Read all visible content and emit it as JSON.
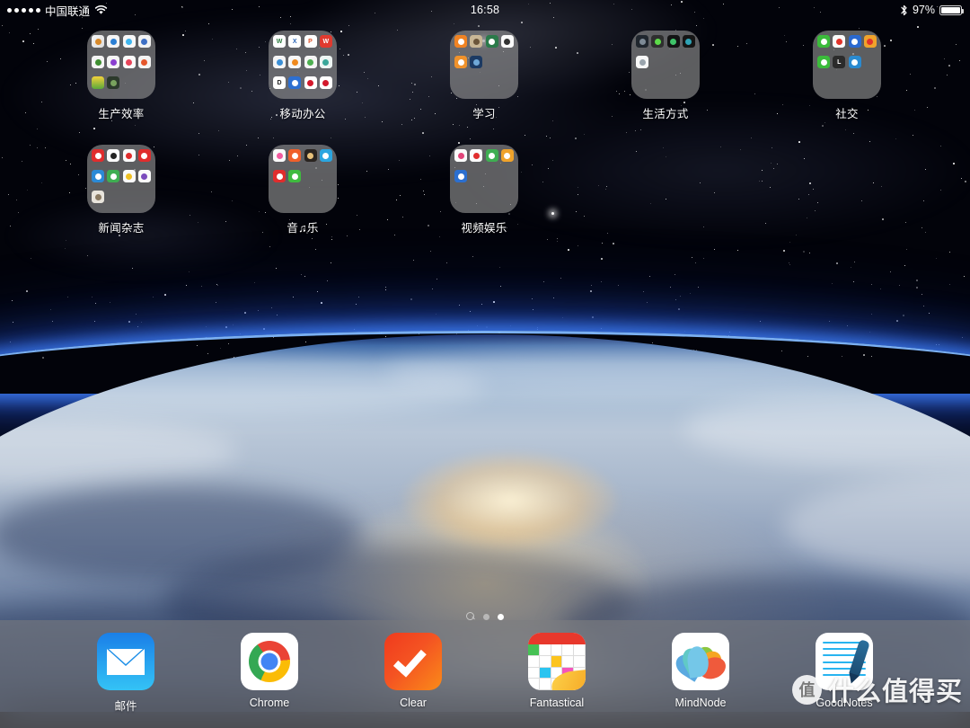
{
  "status_bar": {
    "signal_dots": 5,
    "carrier": "中国联通",
    "wifi_icon": "wifi-icon",
    "time": "16:58",
    "bluetooth_icon": "bluetooth-icon",
    "battery_percent": "97%",
    "battery_icon": "battery-icon"
  },
  "home_screen": {
    "rows": [
      [
        {
          "label": "生产效率",
          "type": "folder",
          "mini_icons": [
            {
              "name": "omnifocus-icon",
              "bg": "linear-gradient(135deg,#f6f6f6,#ddd)",
              "glyph": "",
              "dot": "#d88a2b"
            },
            {
              "name": "onedrive-icon",
              "bg": "#f4f4f4",
              "glyph": "",
              "dot": "#2b7fd4"
            },
            {
              "name": "icloud-drive-icon",
              "bg": "#f7f7f7",
              "glyph": "",
              "dot": "#3fb6ef"
            },
            {
              "name": "documents-icon",
              "bg": "#f2f2f2",
              "glyph": "",
              "dot": "#3d6fc4"
            },
            {
              "name": "evernote-icon",
              "bg": "#f4f4f4",
              "glyph": "",
              "dot": "#3f8f32"
            },
            {
              "name": "notability-icon",
              "bg": "#f4f4f4",
              "glyph": "",
              "dot": "#8a3fd0"
            },
            {
              "name": "pinwheel-icon",
              "bg": "#fbfbfb",
              "glyph": "",
              "dot": "#e8455a"
            },
            {
              "name": "clock-icon",
              "bg": "#f4f4f4",
              "glyph": "",
              "dot": "#e4562b"
            },
            {
              "name": "yellow-app-icon",
              "bg": "linear-gradient(#f3d23b,#5aa83b)",
              "glyph": "",
              "dot": ""
            },
            {
              "name": "dark-app-icon",
              "bg": "#2c3a2c",
              "glyph": "",
              "dot": "#79a35e"
            }
          ]
        },
        {
          "label": "移动办公",
          "type": "folder",
          "mini_icons": [
            {
              "name": "word-icon",
              "bg": "#fff",
              "glyph": "W",
              "dot": "#2b7a3f"
            },
            {
              "name": "excel-icon",
              "bg": "#fff",
              "glyph": "X",
              "dot": "#2b66b8"
            },
            {
              "name": "powerpoint-icon",
              "bg": "#fff",
              "glyph": "P",
              "dot": "#e0542a"
            },
            {
              "name": "wps-icon",
              "bg": "#e03a2f",
              "glyph": "W",
              "dot": "#ffffff"
            },
            {
              "name": "keynote-icon",
              "bg": "#f5f5f5",
              "glyph": "",
              "dot": "#3b8fd6"
            },
            {
              "name": "pages-icon",
              "bg": "#f7f7f7",
              "glyph": "",
              "dot": "#f08a1e"
            },
            {
              "name": "numbers-icon",
              "bg": "#f5f5f5",
              "glyph": "",
              "dot": "#4caf50"
            },
            {
              "name": "scanner-icon",
              "bg": "#eef6f4",
              "glyph": "",
              "dot": "#3aa79a"
            },
            {
              "name": "pdf-icon",
              "bg": "#fff",
              "glyph": "D",
              "dot": "#222222"
            },
            {
              "name": "blue-tool-icon",
              "bg": "#2d6fd0",
              "glyph": "",
              "dot": "#ffffff"
            },
            {
              "name": "red-ring-icon",
              "bg": "#fff",
              "glyph": "",
              "dot": "#d3182c"
            },
            {
              "name": "download-icon",
              "bg": "#fff",
              "glyph": "",
              "dot": "#d3182c"
            }
          ]
        },
        {
          "label": "学习",
          "type": "folder",
          "mini_icons": [
            {
              "name": "orange-study-icon",
              "bg": "#f08323",
              "glyph": "",
              "dot": "#ffffff"
            },
            {
              "name": "books-icon",
              "bg": "#c9b796",
              "glyph": "",
              "dot": "#6b553a"
            },
            {
              "name": "green-board-icon",
              "bg": "#2b7a4a",
              "glyph": "",
              "dot": "#ffffff"
            },
            {
              "name": "white-study-icon",
              "bg": "#fafafa",
              "glyph": "",
              "dot": "#333333"
            },
            {
              "name": "orange-phone-icon",
              "bg": "#f0922b",
              "glyph": "",
              "dot": "#ffffff"
            },
            {
              "name": "night-globe-icon",
              "bg": "#1c3a63",
              "glyph": "",
              "dot": "#6fa8d8"
            }
          ]
        },
        {
          "label": "生活方式",
          "type": "folder",
          "mini_icons": [
            {
              "name": "dark-photo-icon",
              "bg": "#20262e",
              "glyph": "",
              "dot": "#7e8a96"
            },
            {
              "name": "green-frame-icon",
              "bg": "#2f2f2f",
              "glyph": "",
              "dot": "#5ddb49"
            },
            {
              "name": "black-leaf-icon",
              "bg": "#131313",
              "glyph": "",
              "dot": "#3fc469"
            },
            {
              "name": "black-square-icon",
              "bg": "#151515",
              "glyph": "",
              "dot": "#2fa3b5"
            },
            {
              "name": "white-card-icon",
              "bg": "#f8f8f8",
              "glyph": "",
              "dot": "#9aa4ad"
            }
          ]
        },
        {
          "label": "社交",
          "type": "folder",
          "mini_icons": [
            {
              "name": "wechat-icon",
              "bg": "#3bbb3b",
              "glyph": "",
              "dot": "#ffffff"
            },
            {
              "name": "weibo-icon",
              "bg": "#fafafa",
              "glyph": "",
              "dot": "#e2332a"
            },
            {
              "name": "blue-social-icon",
              "bg": "#2a69d0",
              "glyph": "",
              "dot": "#ffffff"
            },
            {
              "name": "qq-orange-icon",
              "bg": "#f0a32b",
              "glyph": "",
              "dot": "#e2332a"
            },
            {
              "name": "green-chat-icon",
              "bg": "#3bbb3b",
              "glyph": "",
              "dot": "#ffffff"
            },
            {
              "name": "linkedin-icon",
              "bg": "#2b2b2b",
              "glyph": "L",
              "dot": "#ffffff"
            },
            {
              "name": "blue-note-icon",
              "bg": "#2a8ad0",
              "glyph": "",
              "dot": "#ffffff"
            }
          ]
        }
      ],
      [
        {
          "label": "新闻杂志",
          "type": "folder",
          "mini_icons": [
            {
              "name": "netease-news-icon",
              "bg": "#e02d2d",
              "glyph": "",
              "dot": "#ffffff"
            },
            {
              "name": "zaker-icon",
              "bg": "#fafafa",
              "glyph": "",
              "dot": "#222222"
            },
            {
              "name": "toutiao-icon",
              "bg": "#fafafa",
              "glyph": "",
              "dot": "#e02d2d"
            },
            {
              "name": "red-magazine-icon",
              "bg": "#e02d2d",
              "glyph": "",
              "dot": "#ffffff"
            },
            {
              "name": "blue-reader-icon",
              "bg": "#2b8ad6",
              "glyph": "",
              "dot": "#ffffff"
            },
            {
              "name": "green-reader-icon",
              "bg": "#3fae52",
              "glyph": "",
              "dot": "#ffffff"
            },
            {
              "name": "yellow-news-icon",
              "bg": "#fafafa",
              "glyph": "",
              "dot": "#f0c024"
            },
            {
              "name": "purple-feed-icon",
              "bg": "#fafafa",
              "glyph": "",
              "dot": "#7b4bbd"
            },
            {
              "name": "photo-news-icon",
              "bg": "#e8e4dc",
              "glyph": "",
              "dot": "#8a7a62"
            }
          ]
        },
        {
          "label": "音♫乐",
          "type": "folder",
          "mini_icons": [
            {
              "name": "music-note-icon",
              "bg": "#f9f9f9",
              "glyph": "",
              "dot": "#f25a9e"
            },
            {
              "name": "xiami-icon",
              "bg": "#f0602b",
              "glyph": "",
              "dot": "#ffffff"
            },
            {
              "name": "dark-radio-icon",
              "bg": "#2a2420",
              "glyph": "",
              "dot": "#e8c17a"
            },
            {
              "name": "blue-music-icon",
              "bg": "#2ba6e0",
              "glyph": "",
              "dot": "#ffffff"
            },
            {
              "name": "netease-music-icon",
              "bg": "#e02d2d",
              "glyph": "",
              "dot": "#ffffff"
            },
            {
              "name": "qq-music-icon",
              "bg": "#3fbb3f",
              "glyph": "",
              "dot": "#ffffff"
            }
          ]
        },
        {
          "label": "视频娱乐",
          "type": "folder",
          "mini_icons": [
            {
              "name": "bilibili-icon",
              "bg": "#fafafa",
              "glyph": "",
              "dot": "#e2457a"
            },
            {
              "name": "youku-icon",
              "bg": "#fafafa",
              "glyph": "",
              "dot": "#e02d2d"
            },
            {
              "name": "iqiyi-icon",
              "bg": "#3fae52",
              "glyph": "",
              "dot": "#ffffff"
            },
            {
              "name": "sohu-video-icon",
              "bg": "#f0a32b",
              "glyph": "",
              "dot": "#ffffff"
            },
            {
              "name": "blue-video-icon",
              "bg": "#2b6fd0",
              "glyph": "",
              "dot": "#ffffff"
            }
          ]
        }
      ]
    ]
  },
  "page_indicator": {
    "search_icon": "search-icon",
    "total_pages": 2,
    "active_page": 2
  },
  "dock": {
    "apps": [
      {
        "label": "邮件",
        "icon": "mail-icon"
      },
      {
        "label": "Chrome",
        "icon": "chrome-icon"
      },
      {
        "label": "Clear",
        "icon": "clear-icon"
      },
      {
        "label": "Fantastical",
        "icon": "fantastical-icon"
      },
      {
        "label": "MindNode",
        "icon": "mindnode-icon"
      },
      {
        "label": "GoodNotes",
        "icon": "goodnotes-icon"
      }
    ]
  },
  "watermark": {
    "logo_glyph": "值",
    "text": "什么值得买"
  },
  "colors": {
    "folder_bg": "#969696",
    "dock_bg": "#7d7d80",
    "label_text": "#ffffff",
    "atmosphere_blue": "#3c78eb"
  }
}
